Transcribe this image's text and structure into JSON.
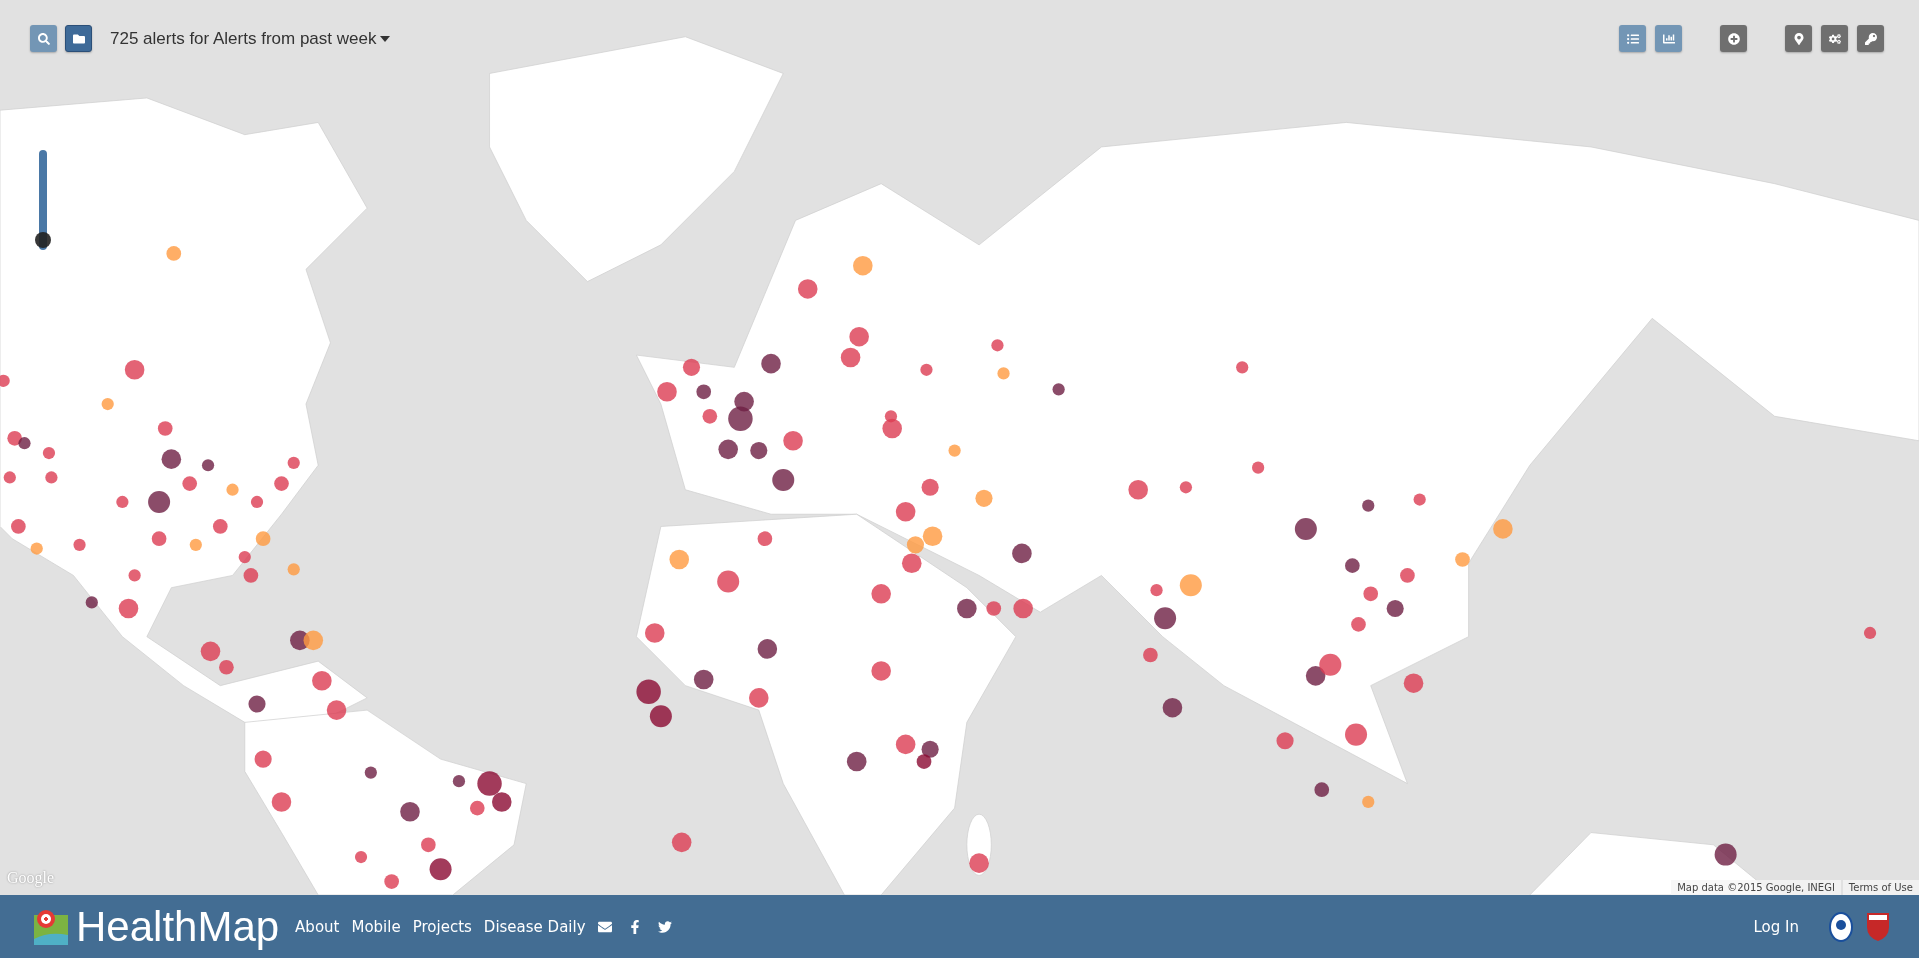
{
  "toolbar": {
    "buttons": [
      {
        "selected": false
      },
      {
        "selected": true
      }
    ],
    "title": "725 alerts for Alerts from past week"
  },
  "zoom_slider": {
    "level": 0.1
  },
  "map": {
    "logo": "Google",
    "attribution": "Map data ©2015 Google, INEGI",
    "terms": "Terms of Use"
  },
  "footer": {
    "brand": "HealthMap",
    "links": [
      "About",
      "Mobile",
      "Projects",
      "Disease Daily"
    ],
    "login": "Log In"
  }
}
